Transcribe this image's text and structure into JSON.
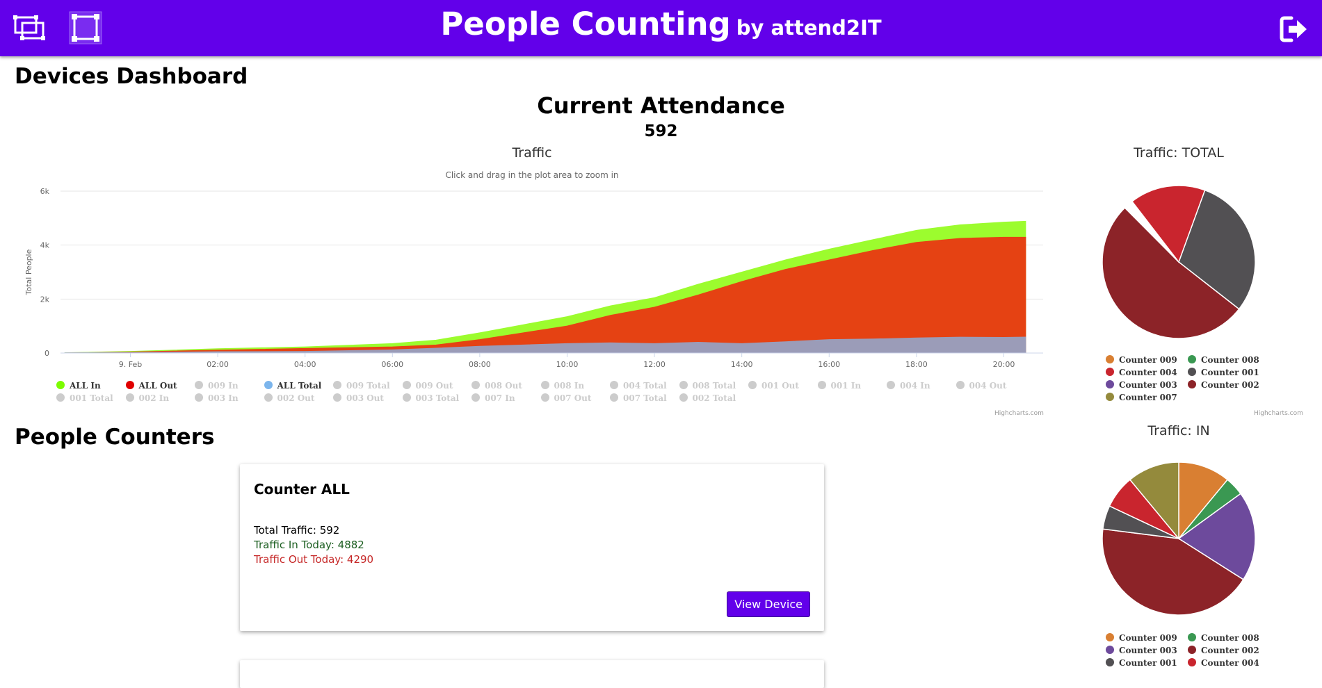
{
  "header": {
    "title": "People Counting",
    "subtitle": "by attend2IT",
    "color": "#6200ea"
  },
  "page": {
    "dashboard_heading": "Devices Dashboard",
    "attendance_title": "Current Attendance",
    "attendance_value": "592",
    "counters_heading": "People Counters"
  },
  "traffic_chart": {
    "title": "Traffic",
    "subtitle": "Click and drag in the plot area to zoom in",
    "credits": "Highcharts.com",
    "legend": [
      {
        "label": "ALL In",
        "color": "#7cfc00",
        "visible": true
      },
      {
        "label": "ALL Out",
        "color": "#e00000",
        "visible": true
      },
      {
        "label": "009 In",
        "color": "#cccccc",
        "visible": false
      },
      {
        "label": "ALL Total",
        "color": "#7cb5ec",
        "visible": true
      },
      {
        "label": "009 Total",
        "color": "#cccccc",
        "visible": false
      },
      {
        "label": "009 Out",
        "color": "#cccccc",
        "visible": false
      },
      {
        "label": "008 Out",
        "color": "#cccccc",
        "visible": false
      },
      {
        "label": "008 In",
        "color": "#cccccc",
        "visible": false
      },
      {
        "label": "004 Total",
        "color": "#cccccc",
        "visible": false
      },
      {
        "label": "008 Total",
        "color": "#cccccc",
        "visible": false
      },
      {
        "label": "001 Out",
        "color": "#cccccc",
        "visible": false
      },
      {
        "label": "001 In",
        "color": "#cccccc",
        "visible": false
      },
      {
        "label": "004 In",
        "color": "#cccccc",
        "visible": false
      },
      {
        "label": "004 Out",
        "color": "#cccccc",
        "visible": false
      },
      {
        "label": "001 Total",
        "color": "#cccccc",
        "visible": false
      },
      {
        "label": "002 In",
        "color": "#cccccc",
        "visible": false
      },
      {
        "label": "003 In",
        "color": "#cccccc",
        "visible": false
      },
      {
        "label": "002 Out",
        "color": "#cccccc",
        "visible": false
      },
      {
        "label": "003 Out",
        "color": "#cccccc",
        "visible": false
      },
      {
        "label": "003 Total",
        "color": "#cccccc",
        "visible": false
      },
      {
        "label": "007 In",
        "color": "#cccccc",
        "visible": false
      },
      {
        "label": "007 Out",
        "color": "#cccccc",
        "visible": false
      },
      {
        "label": "007 Total",
        "color": "#cccccc",
        "visible": false
      },
      {
        "label": "002 Total",
        "color": "#cccccc",
        "visible": false
      }
    ]
  },
  "chart_data": [
    {
      "type": "area",
      "title": "Traffic",
      "subtitle": "Click and drag in the plot area to zoom in",
      "xlabel": "",
      "ylabel": "Total People",
      "ylim": [
        0,
        6000
      ],
      "yticks": [
        0,
        2000,
        4000,
        6000
      ],
      "ytick_labels": [
        "0",
        "2k",
        "4k",
        "6k"
      ],
      "xlim": [
        -1.6,
        20.9
      ],
      "xticks": [
        0,
        2,
        4,
        6,
        8,
        10,
        12,
        14,
        16,
        18,
        20
      ],
      "xtick_labels": [
        "9. Feb",
        "02:00",
        "04:00",
        "06:00",
        "08:00",
        "10:00",
        "12:00",
        "14:00",
        "16:00",
        "18:00",
        "20:00"
      ],
      "grid": true,
      "x": [
        -1.5,
        0,
        2,
        4,
        6,
        7,
        8,
        9,
        10,
        11,
        12,
        13,
        14,
        15,
        16,
        17,
        18,
        19,
        20,
        20.5
      ],
      "series": [
        {
          "name": "ALL In",
          "color": "#9cfc2e",
          "values": [
            10,
            60,
            160,
            230,
            350,
            480,
            750,
            1050,
            1350,
            1750,
            2050,
            2550,
            3000,
            3450,
            3850,
            4200,
            4550,
            4750,
            4850,
            4882
          ]
        },
        {
          "name": "ALL Out",
          "color": "#e54213",
          "values": [
            0,
            40,
            110,
            170,
            230,
            300,
            500,
            750,
            1000,
            1400,
            1700,
            2150,
            2650,
            3100,
            3450,
            3800,
            4100,
            4250,
            4290,
            4290
          ]
        },
        {
          "name": "ALL Total",
          "color": "#9b9cb8",
          "values": [
            10,
            20,
            50,
            60,
            120,
            180,
            250,
            300,
            350,
            380,
            350,
            400,
            350,
            420,
            500,
            520,
            560,
            590,
            580,
            592
          ]
        }
      ]
    },
    {
      "type": "pie",
      "title": "Traffic: TOTAL",
      "legend": [
        "Counter 009",
        "Counter 008",
        "Counter 004",
        "Counter 001",
        "Counter 003",
        "Counter 002",
        "Counter 007"
      ],
      "slices": [
        {
          "name": "Counter 001",
          "color": "#525053",
          "value": 30
        },
        {
          "name": "Counter 002",
          "color": "#8c2328",
          "value": 52
        },
        {
          "name": "Counter 009",
          "color": "#ffffff",
          "value": 1
        },
        {
          "name": "Counter 008",
          "color": "#ffffff",
          "value": 1
        },
        {
          "name": "Counter 004",
          "color": "#c9252e",
          "value": 16
        }
      ]
    },
    {
      "type": "pie",
      "title": "Traffic: IN",
      "legend": [
        "Counter 009",
        "Counter 008",
        "Counter 003",
        "Counter 002",
        "Counter 001",
        "Counter 004"
      ],
      "slices": [
        {
          "name": "Counter 009",
          "color": "#d97f32",
          "value": 11
        },
        {
          "name": "Counter 008",
          "color": "#3a9852",
          "value": 4
        },
        {
          "name": "Counter 003",
          "color": "#6d4a9c",
          "value": 19
        },
        {
          "name": "Counter 002",
          "color": "#8c2328",
          "value": 43
        },
        {
          "name": "Counter 001",
          "color": "#525053",
          "value": 5
        },
        {
          "name": "Counter 004",
          "color": "#c9252e",
          "value": 7
        },
        {
          "name": "Counter 007",
          "color": "#948a3c",
          "value": 11
        }
      ]
    }
  ],
  "pie_total": {
    "title": "Traffic: TOTAL",
    "credits": "Highcharts.com",
    "legend": [
      {
        "label": "Counter 009",
        "color": "#d97f32"
      },
      {
        "label": "Counter 008",
        "color": "#3a9852"
      },
      {
        "label": "Counter 004",
        "color": "#c9252e"
      },
      {
        "label": "Counter 001",
        "color": "#525053"
      },
      {
        "label": "Counter 003",
        "color": "#6d4a9c"
      },
      {
        "label": "Counter 002",
        "color": "#8c2328"
      },
      {
        "label": "Counter 007",
        "color": "#948a3c"
      }
    ]
  },
  "pie_in": {
    "title": "Traffic: IN",
    "legend": [
      {
        "label": "Counter 009",
        "color": "#d97f32"
      },
      {
        "label": "Counter 008",
        "color": "#3a9852"
      },
      {
        "label": "Counter 003",
        "color": "#6d4a9c"
      },
      {
        "label": "Counter 002",
        "color": "#8c2328"
      },
      {
        "label": "Counter 001",
        "color": "#525053"
      },
      {
        "label": "Counter 004",
        "color": "#c9252e"
      }
    ]
  },
  "counter_card": {
    "title": "Counter ALL",
    "total": "Total Traffic: 592",
    "in": "Traffic In Today: 4882",
    "out": "Traffic Out Today: 4290",
    "button": "View Device",
    "in_color": "#1b5e20",
    "out_color": "#c62828"
  }
}
